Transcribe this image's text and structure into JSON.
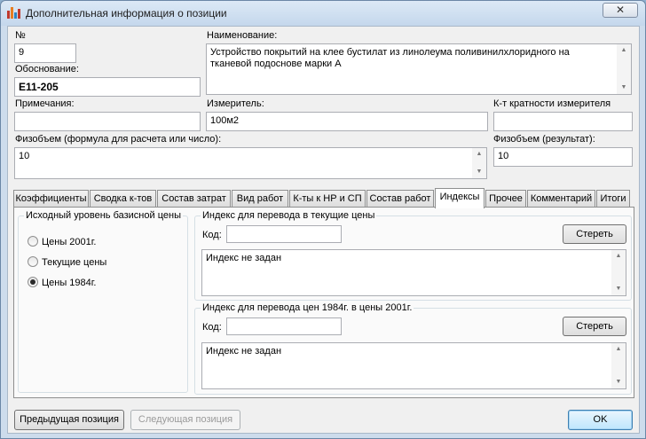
{
  "window": {
    "title": "Дополнительная информация о позиции",
    "close_label": "✕"
  },
  "form": {
    "number_label": "№",
    "number_value": "9",
    "basis_label": "Обоснование:",
    "basis_value": "Е11-205",
    "name_label": "Наименование:",
    "name_value": "Устройство покрытий на клее бустилат из линолеума поливинилхлоридного на тканевой подоснове марки А",
    "notes_label": "Примечания:",
    "notes_value": "",
    "meter_label": "Измеритель:",
    "meter_value": "100м2",
    "multiplicity_label": "К-т кратности измерителя",
    "multiplicity_value": "",
    "volume_formula_label": "Физобъем (формула для расчета или число):",
    "volume_formula_value": "10",
    "volume_result_label": "Физобъем (результат):",
    "volume_result_value": "10"
  },
  "tabs": [
    {
      "label": "Коэффициенты"
    },
    {
      "label": "Сводка к-тов"
    },
    {
      "label": "Состав затрат"
    },
    {
      "label": "Вид работ"
    },
    {
      "label": "К-ты к НР и СП"
    },
    {
      "label": "Состав работ"
    },
    {
      "label": "Индексы"
    },
    {
      "label": "Прочее"
    },
    {
      "label": "Комментарий"
    },
    {
      "label": "Итоги"
    }
  ],
  "active_tab": "Индексы",
  "indexes": {
    "base_level_title": "Исходный уровень базисной цены",
    "options": [
      {
        "label": "Цены 2001г.",
        "checked": false
      },
      {
        "label": "Текущие цены",
        "checked": false
      },
      {
        "label": "Цены 1984г.",
        "checked": true
      }
    ],
    "current_group": {
      "title": "Индекс для перевода в текущие цены",
      "code_label": "Код:",
      "code_value": "",
      "clear_label": "Стереть",
      "text": "Индекс не задан"
    },
    "convert_group": {
      "title": "Индекс для перевода цен 1984г. в цены 2001г.",
      "code_label": "Код:",
      "code_value": "",
      "clear_label": "Стереть",
      "text": "Индекс не задан"
    }
  },
  "footer": {
    "prev_label": "Предыдущая позиция",
    "next_label": "Следующая позиция",
    "ok_label": "OK"
  }
}
